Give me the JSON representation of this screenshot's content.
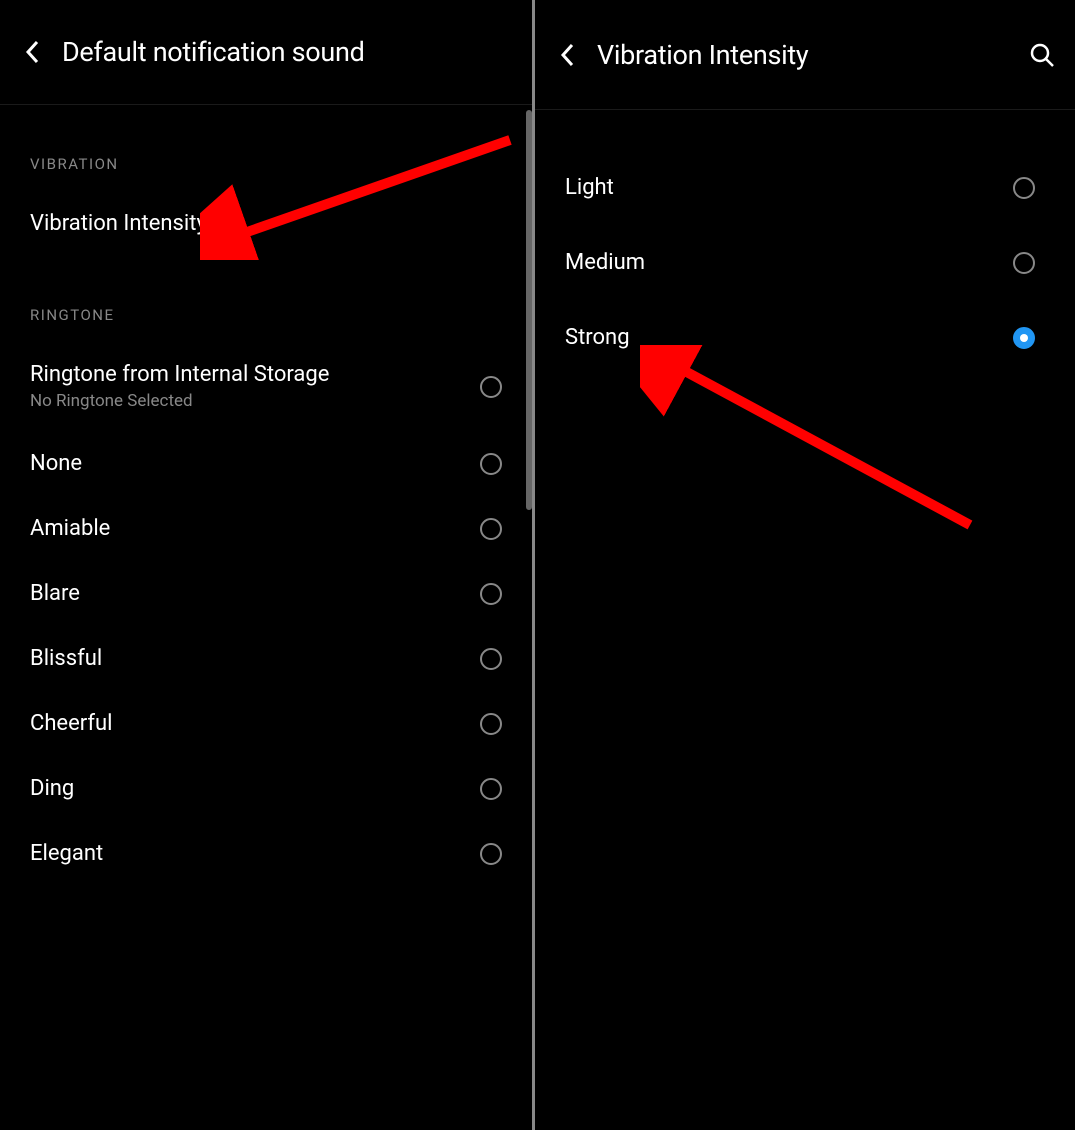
{
  "left": {
    "title": "Default notification sound",
    "vibration_header": "VIBRATION",
    "vibration_intensity_label": "Vibration Intensity",
    "ringtone_header": "RINGTONE",
    "ringtone_storage": {
      "label": "Ringtone from Internal Storage",
      "sub": "No Ringtone Selected"
    },
    "ringtones": [
      {
        "label": "None"
      },
      {
        "label": "Amiable"
      },
      {
        "label": "Blare"
      },
      {
        "label": "Blissful"
      },
      {
        "label": "Cheerful"
      },
      {
        "label": "Ding"
      },
      {
        "label": "Elegant"
      }
    ]
  },
  "right": {
    "title": "Vibration Intensity",
    "options": [
      {
        "label": "Light",
        "selected": false
      },
      {
        "label": "Medium",
        "selected": false
      },
      {
        "label": "Strong",
        "selected": true
      }
    ]
  }
}
